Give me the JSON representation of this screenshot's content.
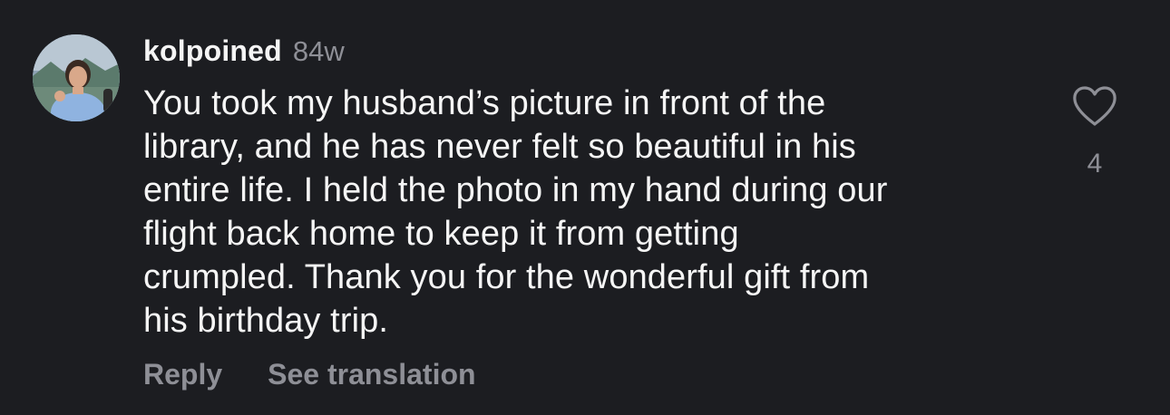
{
  "comment": {
    "username": "kolpoined",
    "age": "84w",
    "text_lines": [
      "You took my husband’s picture in front of the",
      "library, and he has never felt so beautiful in his",
      "entire life. I held the photo in my hand during our",
      "flight back home to keep it from getting",
      "crumpled. Thank you for the wonderful gift from",
      "his birthday trip."
    ],
    "like_count": "4",
    "actions": {
      "reply": "Reply",
      "see_translation": "See translation"
    }
  },
  "icons": {
    "like": "heart-outline-icon",
    "avatar": "profile-photo"
  },
  "colors": {
    "background": "#1c1d21",
    "primary_text": "#f5f5f5",
    "secondary_text": "#8e8f96"
  }
}
